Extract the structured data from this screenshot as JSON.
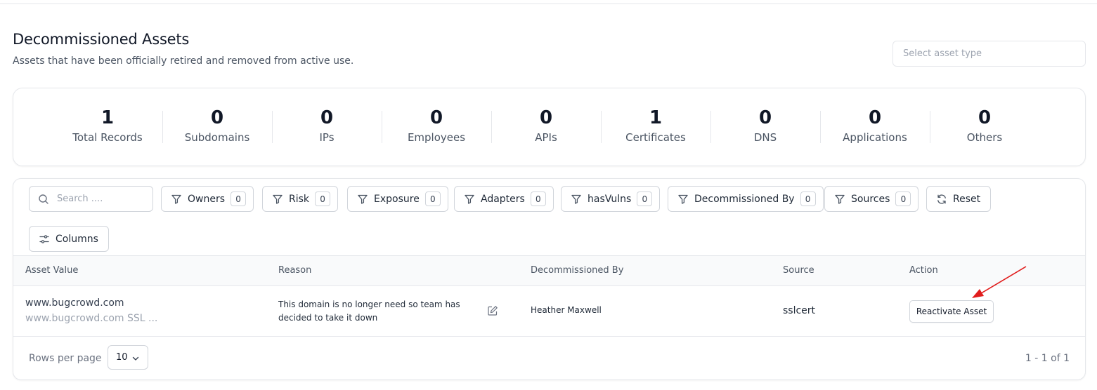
{
  "header": {
    "title": "Decommissioned Assets",
    "subtitle": "Assets that have been officially retired and removed from active use.",
    "asset_type_placeholder": "Select asset type"
  },
  "stats": [
    {
      "value": "1",
      "label": "Total Records"
    },
    {
      "value": "0",
      "label": "Subdomains"
    },
    {
      "value": "0",
      "label": "IPs"
    },
    {
      "value": "0",
      "label": "Employees"
    },
    {
      "value": "0",
      "label": "APIs"
    },
    {
      "value": "1",
      "label": "Certificates"
    },
    {
      "value": "0",
      "label": "DNS"
    },
    {
      "value": "0",
      "label": "Applications"
    },
    {
      "value": "0",
      "label": "Others"
    }
  ],
  "toolbar": {
    "search_placeholder": "Search ....",
    "filters": [
      {
        "label": "Owners",
        "count": "0"
      },
      {
        "label": "Risk",
        "count": "0"
      },
      {
        "label": "Exposure",
        "count": "0"
      },
      {
        "label": "Adapters",
        "count": "0"
      },
      {
        "label": "hasVulns",
        "count": "0"
      },
      {
        "label": "Decommissioned By",
        "count": "0"
      },
      {
        "label": "Sources",
        "count": "0"
      }
    ],
    "reset_label": "Reset",
    "columns_label": "Columns"
  },
  "table": {
    "columns": [
      "Asset Value",
      "Reason",
      "Decommissioned By",
      "Source",
      "Action"
    ],
    "rows": [
      {
        "asset_value": "www.bugcrowd.com",
        "asset_subtitle": "www.bugcrowd.com SSL ...",
        "reason": "This domain is no longer need so team has decided to take it down",
        "decommissioned_by": "Heather Maxwell",
        "source": "sslcert",
        "action_label": "Reactivate Asset"
      }
    ]
  },
  "footer": {
    "rows_per_page_label": "Rows per page",
    "rows_per_page_value": "10",
    "pagination": "1 - 1 of 1"
  },
  "colors": {
    "annotation_arrow": "#e11d1d",
    "border": "#e5e7eb",
    "header_bg": "#f9fafb"
  }
}
